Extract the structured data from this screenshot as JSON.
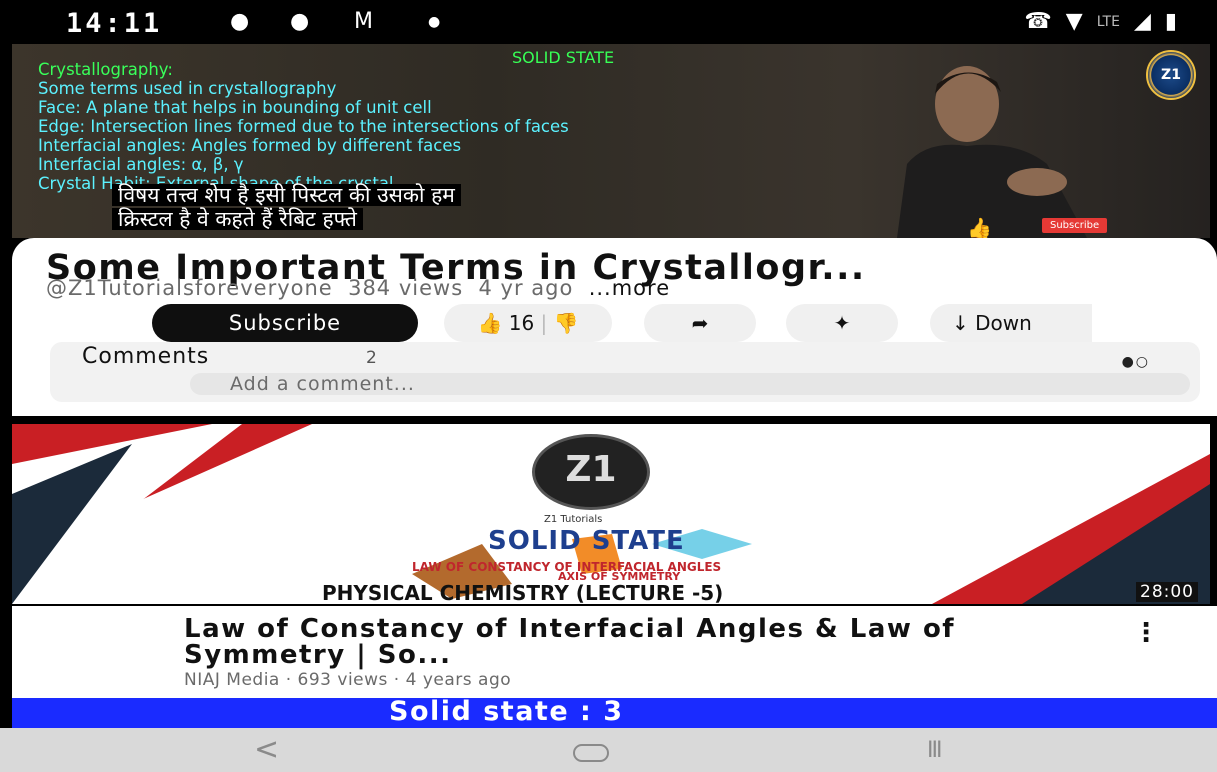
{
  "status_bar": {
    "time": "14:11",
    "notifications": [
      "message-icon",
      "message-icon",
      "gmail-icon",
      "dot-icon"
    ],
    "right": {
      "lte": "LTE"
    }
  },
  "player": {
    "slide_title": "SOLID STATE",
    "lines": [
      "Crystallography:",
      "Some terms used in crystallography",
      "Face:  A plane that helps in bounding of unit cell",
      "Edge: Intersection lines formed due to the intersections of faces",
      "Interfacial angles: Angles formed by different faces",
      "Interfacial angles:  α, β, γ",
      " Crystal Habit: External shape of the crystal"
    ],
    "caption_lines": [
      "विषय तत्त्व शेप है इसी पिस्टल की उसको हम",
      "क्रिस्टल है वे कहते हैं रैबिट हफ्ते"
    ],
    "logo_text": "Z1",
    "subscribe_small": "Subscribe"
  },
  "video": {
    "title": "Some Important Terms in Crystallogr...",
    "channel": "@Z1Tutorialsforeveryone",
    "views": "384 views",
    "age": "4 yr ago",
    "more": "...more",
    "subscribe": "Subscribe",
    "likes": "16",
    "download": "Down"
  },
  "comments": {
    "label": "Comments",
    "count": "2",
    "placeholder": "Add a comment..."
  },
  "next_video": {
    "thumb": {
      "logo": "Z1",
      "brand": "Z1 Tutorials",
      "heading": "SOLID STATE",
      "line1": "LAW OF CONSTANCY OF INTERFACIAL ANGLES",
      "line2": "AXIS OF SYMMETRY",
      "line3": "PHYSICAL CHEMISTRY (LECTURE -5)",
      "duration": "28:00"
    },
    "title": "Law of Constancy of Interfacial Angles & Law of Symmetry | So...",
    "meta": "NIAJ Media · 693 views · 4 years ago"
  },
  "third_video": {
    "strip_text": "Solid state : 3"
  },
  "nav": {
    "back": "<",
    "recent": "III"
  }
}
